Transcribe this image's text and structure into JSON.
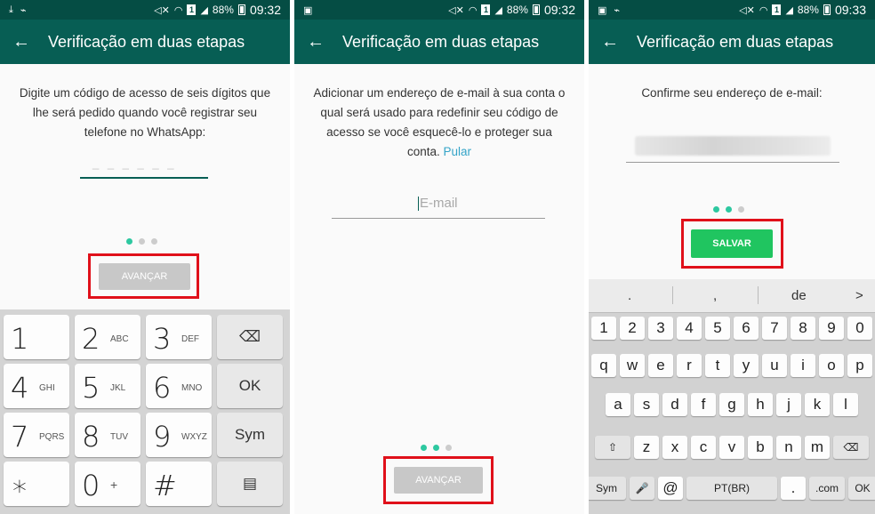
{
  "status": {
    "battery": "88%",
    "times": [
      "09:32",
      "09:32",
      "09:33"
    ],
    "sim": "1"
  },
  "appbar": {
    "title": "Verificação em duas etapas"
  },
  "panel1": {
    "description": "Digite um código de acesso de seis dígitos que lhe será pedido quando você registrar seu telefone no WhatsApp:",
    "pin_placeholder": "_ _ _   _ _ _",
    "button": "AVANÇAR",
    "page_indicator": {
      "current": 1,
      "total": 3
    },
    "keypad": [
      [
        {
          "k": "1",
          "s": ""
        },
        {
          "k": "2",
          "s": "ABC"
        },
        {
          "k": "3",
          "s": "DEF"
        },
        {
          "k": "backspace",
          "s": ""
        }
      ],
      [
        {
          "k": "4",
          "s": "GHI"
        },
        {
          "k": "5",
          "s": "JKL"
        },
        {
          "k": "6",
          "s": "MNO"
        },
        {
          "k": "OK",
          "s": ""
        }
      ],
      [
        {
          "k": "7",
          "s": "PQRS"
        },
        {
          "k": "8",
          "s": "TUV"
        },
        {
          "k": "9",
          "s": "WXYZ"
        },
        {
          "k": "Sym",
          "s": ""
        }
      ],
      [
        {
          "k": "*",
          "s": ""
        },
        {
          "k": "0",
          "s": "+"
        },
        {
          "k": "#",
          "s": ""
        },
        {
          "k": "clipboard",
          "s": ""
        }
      ]
    ]
  },
  "panel2": {
    "description": "Adicionar um endereço de e-mail à sua conta o qual será usado para redefinir seu código de acesso se você esquecê-lo e proteger sua conta.",
    "skip_link": "Pular",
    "email_placeholder": "E-mail",
    "button": "AVANÇAR",
    "page_indicator": {
      "current": 2,
      "total": 3
    }
  },
  "panel3": {
    "description": "Confirme seu endereço de e-mail:",
    "button": "SALVAR",
    "page_indicator": {
      "current": 2,
      "total": 3
    },
    "suggestions": [
      ".",
      ",",
      "de",
      ">"
    ],
    "rows": [
      [
        "1",
        "2",
        "3",
        "4",
        "5",
        "6",
        "7",
        "8",
        "9",
        "0"
      ],
      [
        "q",
        "w",
        "e",
        "r",
        "t",
        "y",
        "u",
        "i",
        "o",
        "p"
      ],
      [
        "a",
        "s",
        "d",
        "f",
        "g",
        "h",
        "j",
        "k",
        "l"
      ],
      [
        "⇧",
        "z",
        "x",
        "c",
        "v",
        "b",
        "n",
        "m",
        "⌫"
      ],
      [
        "Sym",
        "🎤",
        "@",
        "PT(BR)",
        ".",
        ".com",
        "OK"
      ]
    ]
  }
}
